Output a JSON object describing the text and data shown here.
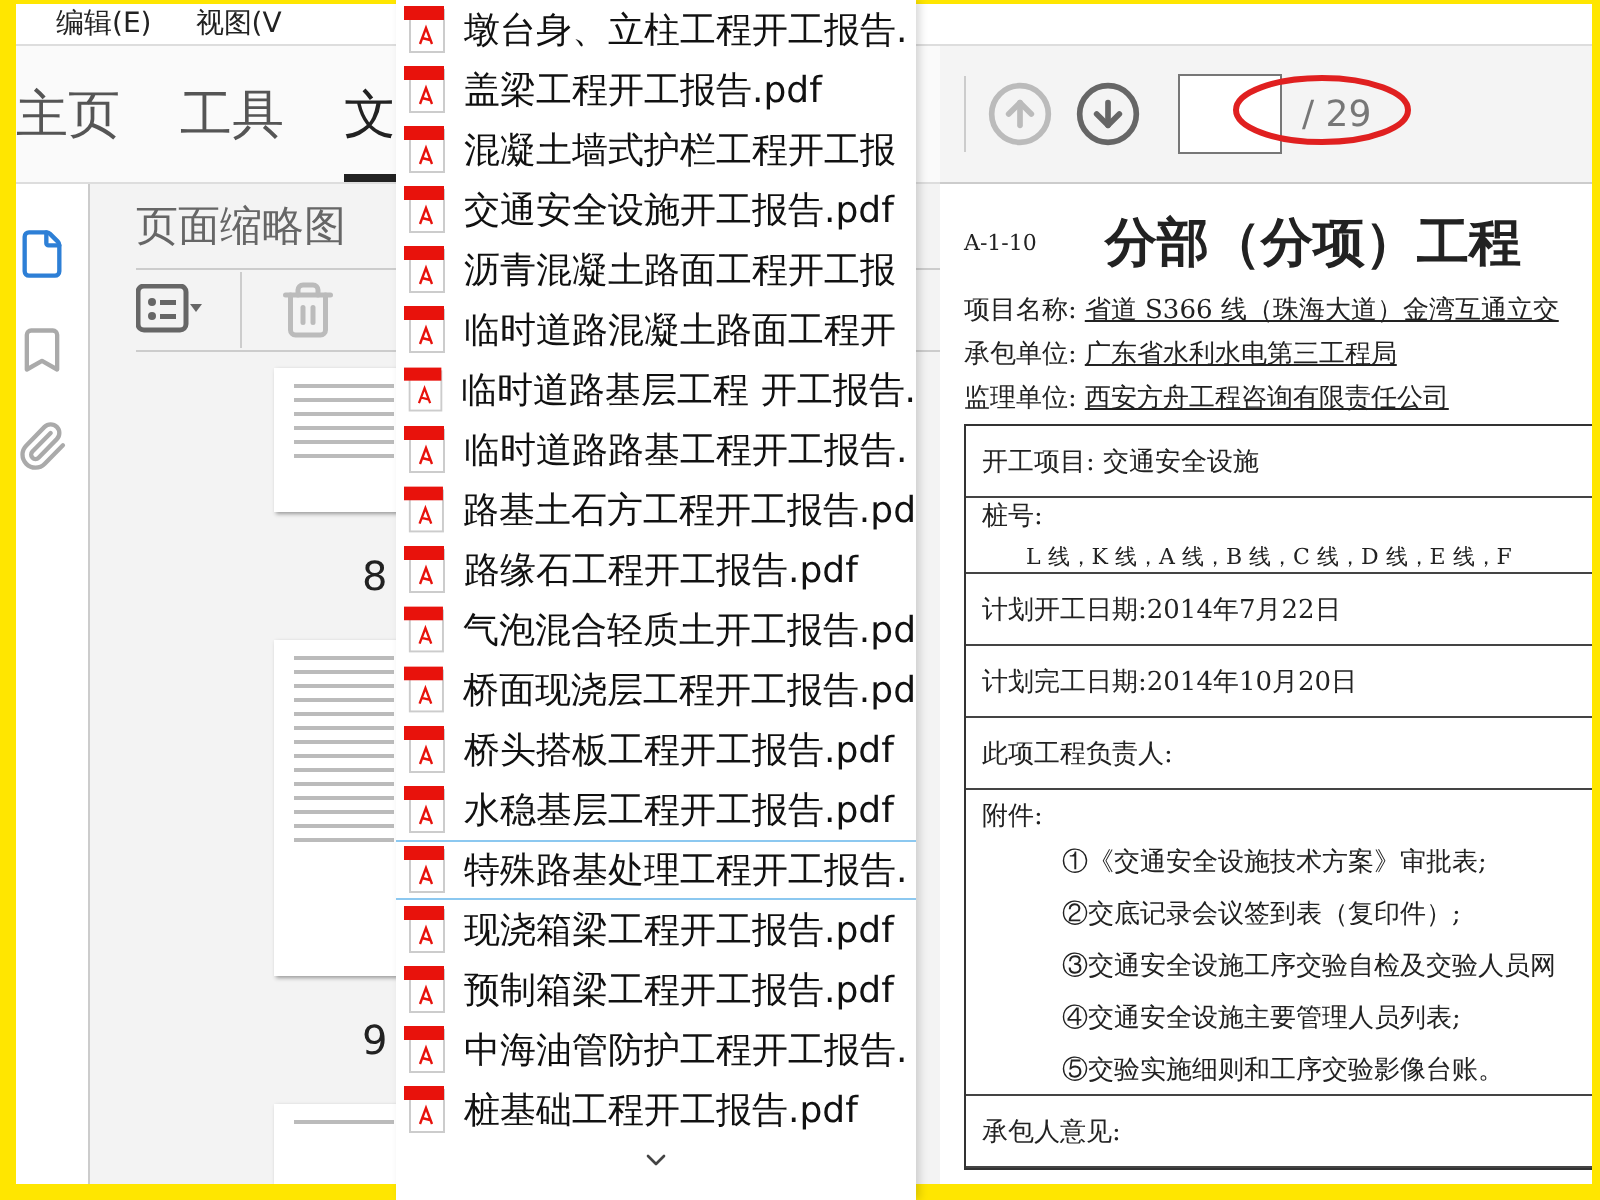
{
  "menu": [
    "编辑(E)",
    "视图(V"
  ],
  "tabs": [
    {
      "label": "主页",
      "selected": false
    },
    {
      "label": "工具",
      "selected": false
    },
    {
      "label": "文",
      "selected": true
    }
  ],
  "rail": [
    {
      "kind": "pages",
      "selected": true
    },
    {
      "kind": "bookmarks",
      "selected": false
    },
    {
      "kind": "attachments",
      "selected": false
    }
  ],
  "thumbnail_panel": {
    "title": "页面缩略图",
    "pages": [
      "8",
      "9"
    ]
  },
  "file_list": [
    {
      "name": "墩台身、立柱工程开工报告.",
      "hovered": false
    },
    {
      "name": "盖梁工程开工报告.pdf",
      "hovered": false
    },
    {
      "name": "混凝土墙式护栏工程开工报",
      "hovered": false
    },
    {
      "name": "交通安全设施开工报告.pdf",
      "hovered": false
    },
    {
      "name": "沥青混凝土路面工程开工报",
      "hovered": false
    },
    {
      "name": "临时道路混凝土路面工程开",
      "hovered": false
    },
    {
      "name": "临时道路基层工程 开工报告.",
      "hovered": false
    },
    {
      "name": "临时道路路基工程开工报告.",
      "hovered": false
    },
    {
      "name": "路基土石方工程开工报告.pd",
      "hovered": false
    },
    {
      "name": "路缘石工程开工报告.pdf",
      "hovered": false
    },
    {
      "name": "气泡混合轻质土开工报告.pd",
      "hovered": false
    },
    {
      "name": "桥面现浇层工程开工报告.pd",
      "hovered": false
    },
    {
      "name": "桥头搭板工程开工报告.pdf",
      "hovered": false
    },
    {
      "name": "水稳基层工程开工报告.pdf",
      "hovered": false
    },
    {
      "name": "特殊路基处理工程开工报告.",
      "hovered": true
    },
    {
      "name": "现浇箱梁工程开工报告.pdf",
      "hovered": false
    },
    {
      "name": "预制箱梁工程开工报告.pdf",
      "hovered": false
    },
    {
      "name": "中海油管防护工程开工报告.",
      "hovered": false
    },
    {
      "name": "桩基础工程开工报告.pdf",
      "hovered": false
    }
  ],
  "page_nav": {
    "previous_disabled": true,
    "next_disabled": false,
    "total": "/ 29"
  },
  "document": {
    "code": "A-1-10",
    "title": "分部（分项）工程",
    "fields": [
      {
        "label": "项目名称:",
        "value": "省道 S366 线（珠海大道）金湾互通立交"
      },
      {
        "label": "承包单位:",
        "value": "广东省水利水电第三工程局"
      },
      {
        "label": "监理单位:",
        "value": "西安方舟工程咨询有限责任公司"
      }
    ],
    "rows": [
      {
        "kind": "line",
        "text": "开工项目: 交通安全设施"
      },
      {
        "kind": "pile",
        "text": "桩号:",
        "detail": "L 线，K 线，A 线，B 线，C 线，D 线，E 线，F"
      },
      {
        "kind": "line",
        "text": "计划开工日期:2014年7月22日"
      },
      {
        "kind": "line",
        "text": "计划完工日期:2014年10月20日"
      },
      {
        "kind": "line",
        "text": "此项工程负责人:"
      },
      {
        "kind": "attachments",
        "text": "附件:",
        "items": [
          "①《交通安全设施技术方案》审批表;",
          "②交底记录会议签到表（复印件）;",
          "③交通安全设施工序交验自检及交验人员网",
          "④交通安全设施主要管理人员列表;",
          "⑤交验实施细则和工序交验影像台账。"
        ]
      },
      {
        "kind": "line",
        "text": "承包人意见:"
      }
    ]
  }
}
